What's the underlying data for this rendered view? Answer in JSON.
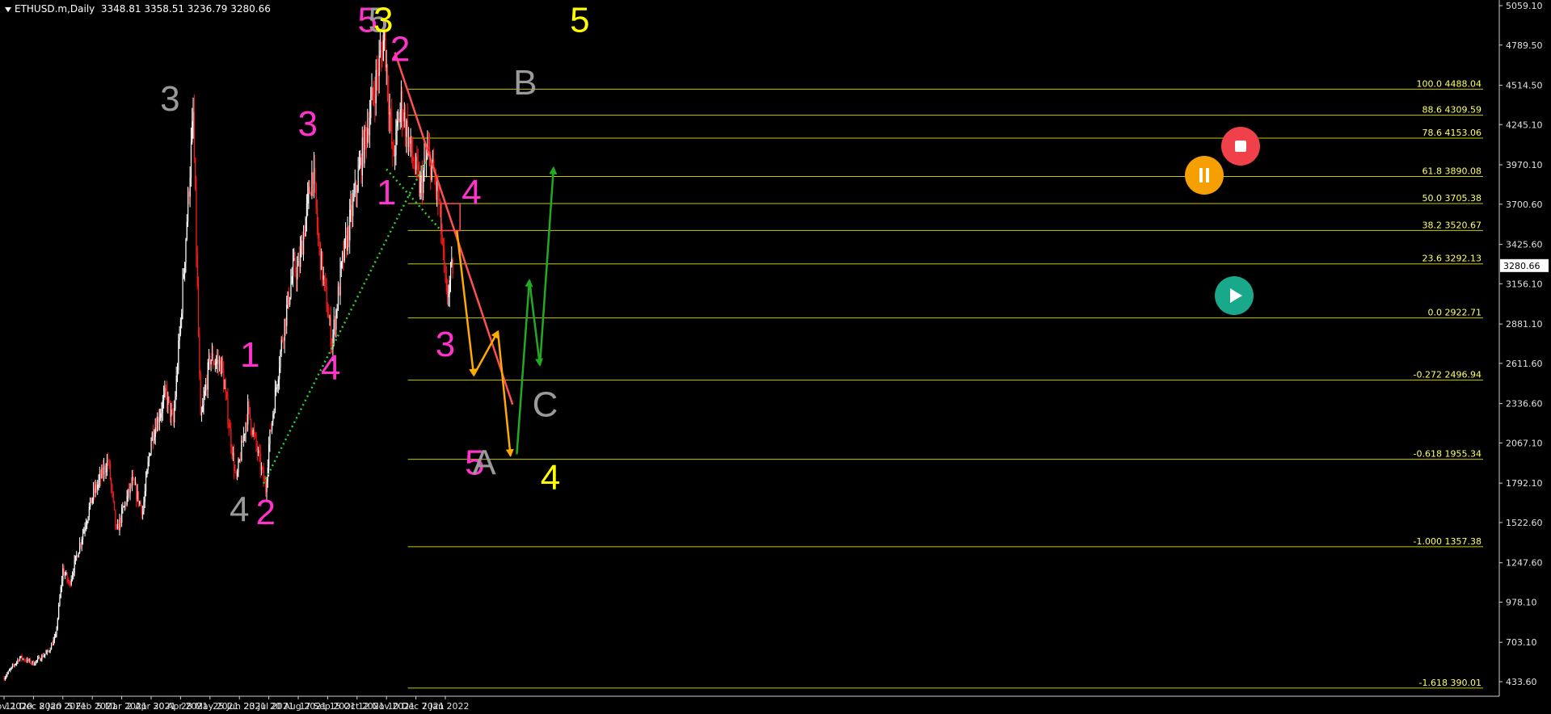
{
  "header": {
    "symbol": "ETHUSD.m,Daily",
    "ohlc": "3348.81 3358.51 3236.79 3280.66"
  },
  "colors": {
    "background": "#000000",
    "bull_candle": "#ffffff",
    "bear_candle": "#ff1a1a",
    "fib_line": "#c8c800",
    "fib_text": "#ffff66",
    "trendline": "#ff5050",
    "support_dotted": "#33cc33",
    "wave_magenta": "#ff33cc",
    "wave_gray": "#9a9a9a",
    "wave_yellow": "#ffff00",
    "arrow_orange": "#ffaa00",
    "arrow_green": "#22aa22",
    "stop_button": "#f0404a",
    "pause_button": "#f5a000",
    "play_button": "#1aa88a"
  },
  "controls": [
    {
      "name": "stop-button-icon",
      "icon": "stop-icon"
    },
    {
      "name": "pause-button-icon",
      "icon": "pause-icon"
    },
    {
      "name": "play-button-icon",
      "icon": "play-icon"
    }
  ],
  "chart_data": {
    "type": "candlestick",
    "instrument": "ETHUSD.m",
    "timeframe": "Daily",
    "y_ticks": [
      "5059.10",
      "4789.50",
      "4514.50",
      "4245.10",
      "3970.10",
      "3700.60",
      "3425.60",
      "3156.10",
      "2881.10",
      "2611.60",
      "2336.60",
      "2067.10",
      "1792.10",
      "1522.60",
      "1247.60",
      "978.10",
      "703.10",
      "433.60"
    ],
    "ylim": [
      310,
      5059.1
    ],
    "current_price": "3280.66",
    "x_ticks": [
      "13 Nov 2020",
      "11 Dec 2020",
      "8 Jan 2021",
      "5 Feb 2021",
      "5 Mar 2021",
      "2 Apr 2021",
      "30 Apr 2021",
      "28 May 2021",
      "25 Jun 2021",
      "23 Jul 2021",
      "20 Aug 2021",
      "17 Sep 2021",
      "15 Oct 2021",
      "12 Nov 2021",
      "10 Dec 2021",
      "7 Jan 2022"
    ],
    "price_path": [
      [
        "13 Nov 2020",
        460
      ],
      [
        "28 Nov 2020",
        600
      ],
      [
        "11 Dec 2020",
        560
      ],
      [
        "25 Dec 2020",
        640
      ],
      [
        "1 Jan 2021",
        740
      ],
      [
        "8 Jan 2021",
        1200
      ],
      [
        "14 Jan 2021",
        1100
      ],
      [
        "5 Feb 2021",
        1700
      ],
      [
        "20 Feb 2021",
        1950
      ],
      [
        "28 Feb 2021",
        1450
      ],
      [
        "5 Mar 2021",
        1580
      ],
      [
        "15 Mar 2021",
        1800
      ],
      [
        "25 Mar 2021",
        1600
      ],
      [
        "2 Apr 2021",
        2100
      ],
      [
        "16 Apr 2021",
        2400
      ],
      [
        "23 Apr 2021",
        2200
      ],
      [
        "30 Apr 2021",
        2900
      ],
      [
        "12 May 2021",
        4300
      ],
      [
        "19 May 2021",
        2200
      ],
      [
        "28 May 2021",
        2650
      ],
      [
        "8 Jun 2021",
        2600
      ],
      [
        "22 Jun 2021",
        1800
      ],
      [
        "3 Jul 2021",
        2300
      ],
      [
        "20 Jul 2021",
        1750
      ],
      [
        "23 Jul 2021",
        2050
      ],
      [
        "5 Aug 2021",
        2800
      ],
      [
        "15 Aug 2021",
        3250
      ],
      [
        "20 Aug 2021",
        3250
      ],
      [
        "3 Sep 2021",
        3950
      ],
      [
        "8 Sep 2021",
        3450
      ],
      [
        "21 Sep 2021",
        2750
      ],
      [
        "1 Oct 2021",
        3300
      ],
      [
        "15 Oct 2021",
        3850
      ],
      [
        "29 Oct 2021",
        4400
      ],
      [
        "10 Nov 2021",
        4850
      ],
      [
        "18 Nov 2021",
        4000
      ],
      [
        "26 Nov 2021",
        4400
      ],
      [
        "4 Dec 2021",
        4100
      ],
      [
        "14 Dec 2021",
        3800
      ],
      [
        "21 Dec 2021",
        4050
      ],
      [
        "27 Dec 2021",
        3900
      ],
      [
        "1 Jan 2022",
        3700
      ],
      [
        "8 Jan 2022",
        3050
      ],
      [
        "14 Jan 2022",
        3280
      ]
    ],
    "fib_levels": [
      {
        "label": "100.0 4488.04",
        "price": 4488.04
      },
      {
        "label": "88.6 4309.59",
        "price": 4309.59
      },
      {
        "label": "78.6 4153.06",
        "price": 4153.06
      },
      {
        "label": "61.8 3890.08",
        "price": 3890.08
      },
      {
        "label": "50.0 3705.38",
        "price": 3705.38
      },
      {
        "label": "38.2 3520.67",
        "price": 3520.67
      },
      {
        "label": "23.6 3292.13",
        "price": 3292.13
      },
      {
        "label": "0.0 2922.71",
        "price": 2922.71
      },
      {
        "label": "-0.272 2496.94",
        "price": 2496.94
      },
      {
        "label": "-0.618 1955.34",
        "price": 1955.34
      },
      {
        "label": "-1.000 1357.38",
        "price": 1357.38
      },
      {
        "label": "-1.618 390.01",
        "price": 390.01
      }
    ],
    "wave_labels": [
      {
        "text": "3",
        "color": "gray",
        "date": "20 Apr 2021",
        "price": 4340
      },
      {
        "text": "4",
        "color": "gray",
        "date": "25 Jun 2021",
        "price": 1530
      },
      {
        "text": "1",
        "color": "magenta",
        "date": "5 Jul 2021",
        "price": 2590
      },
      {
        "text": "2",
        "color": "magenta",
        "date": "20 Jul 2021",
        "price": 1510
      },
      {
        "text": "3",
        "color": "magenta",
        "date": "29 Aug 2021",
        "price": 4170
      },
      {
        "text": "4",
        "color": "magenta",
        "date": "20 Sep 2021",
        "price": 2500
      },
      {
        "text": "5",
        "color": "magenta",
        "date": "25 Oct 2021",
        "price": 4880
      },
      {
        "text": "5",
        "color": "gray",
        "date": "4 Nov 2021",
        "price": 4880
      },
      {
        "text": "3",
        "color": "yellow",
        "date": "9 Nov 2021",
        "price": 4880
      },
      {
        "text": "1",
        "color": "magenta",
        "date": "12 Nov 2021",
        "price": 3700
      },
      {
        "text": "2",
        "color": "magenta",
        "date": "25 Nov 2021",
        "price": 4680
      },
      {
        "text": "3",
        "color": "magenta",
        "date": "7 Jan 2022",
        "price": 2660
      },
      {
        "text": "4",
        "color": "magenta",
        "date": "1 Feb 2022",
        "price": 3700
      },
      {
        "text": "5",
        "color": "magenta",
        "date": "4 Feb 2022",
        "price": 1850
      },
      {
        "text": "A",
        "color": "gray",
        "date": "13 Feb 2022",
        "price": 1850
      },
      {
        "text": "B",
        "color": "gray",
        "date": "24 Mar 2022",
        "price": 4450
      },
      {
        "text": "C",
        "color": "gray",
        "date": "12 Apr 2022",
        "price": 2250
      },
      {
        "text": "5",
        "color": "yellow",
        "date": "15 May 2022",
        "price": 4880
      },
      {
        "text": "4",
        "color": "yellow",
        "date": "17 Apr 2022",
        "price": 1750
      }
    ],
    "trendline_resistance": [
      [
        "20 Nov 2021",
        4740
      ],
      [
        "12 Mar 2022",
        2330
      ]
    ],
    "support_dotted_lines": [
      [
        [
          "18 Jul 2021",
          1790
        ],
        [
          "20 Dec 2021",
          4000
        ]
      ],
      [
        [
          "12 Nov 2021",
          3940
        ],
        [
          "3 Jan 2022",
          3520
        ]
      ]
    ],
    "highlight_box": {
      "date_from": "3 Jan 2022",
      "date_to": "21 Jan 2022",
      "price_low": 3520,
      "price_high": 3705
    },
    "projection_orange": [
      [
        "18 Jan 2022",
        3520
      ],
      [
        "3 Feb 2022",
        2530
      ],
      [
        "26 Feb 2022",
        2830
      ],
      [
        "10 Mar 2022",
        1980
      ]
    ],
    "projection_green": [
      [
        "16 Mar 2022",
        1990
      ],
      [
        "28 Mar 2022",
        3180
      ],
      [
        "7 Apr 2022",
        2600
      ],
      [
        "20 Apr 2022",
        3950
      ]
    ]
  }
}
